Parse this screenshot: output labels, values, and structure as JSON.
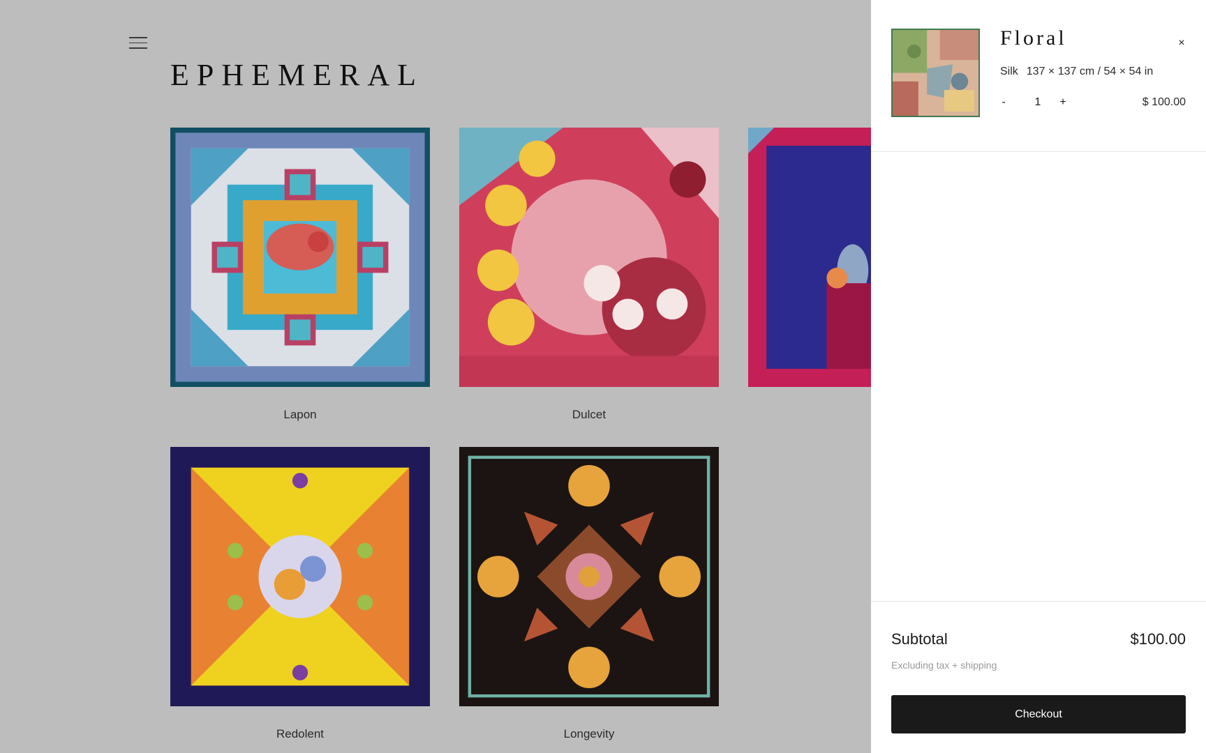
{
  "brand": {
    "name": "EPHEMERAL"
  },
  "products": [
    {
      "name": "Lapon"
    },
    {
      "name": "Dulcet"
    },
    {
      "name": "Redolent"
    },
    {
      "name": "Longevity"
    }
  ],
  "cart": {
    "item": {
      "title": "Floral",
      "material": "Silk",
      "size": "137 × 137 cm / 54 × 54 in",
      "quantity": "1",
      "minus_label": "-",
      "plus_label": "+",
      "price": "$ 100.00"
    },
    "close_label": "×",
    "subtotal_label": "Subtotal",
    "subtotal_value": "$100.00",
    "tax_note": "Excluding tax + shipping",
    "checkout_label": "Checkout"
  },
  "colors": {
    "overlay": "#bdbdbd",
    "button": "#1a1a1a"
  }
}
